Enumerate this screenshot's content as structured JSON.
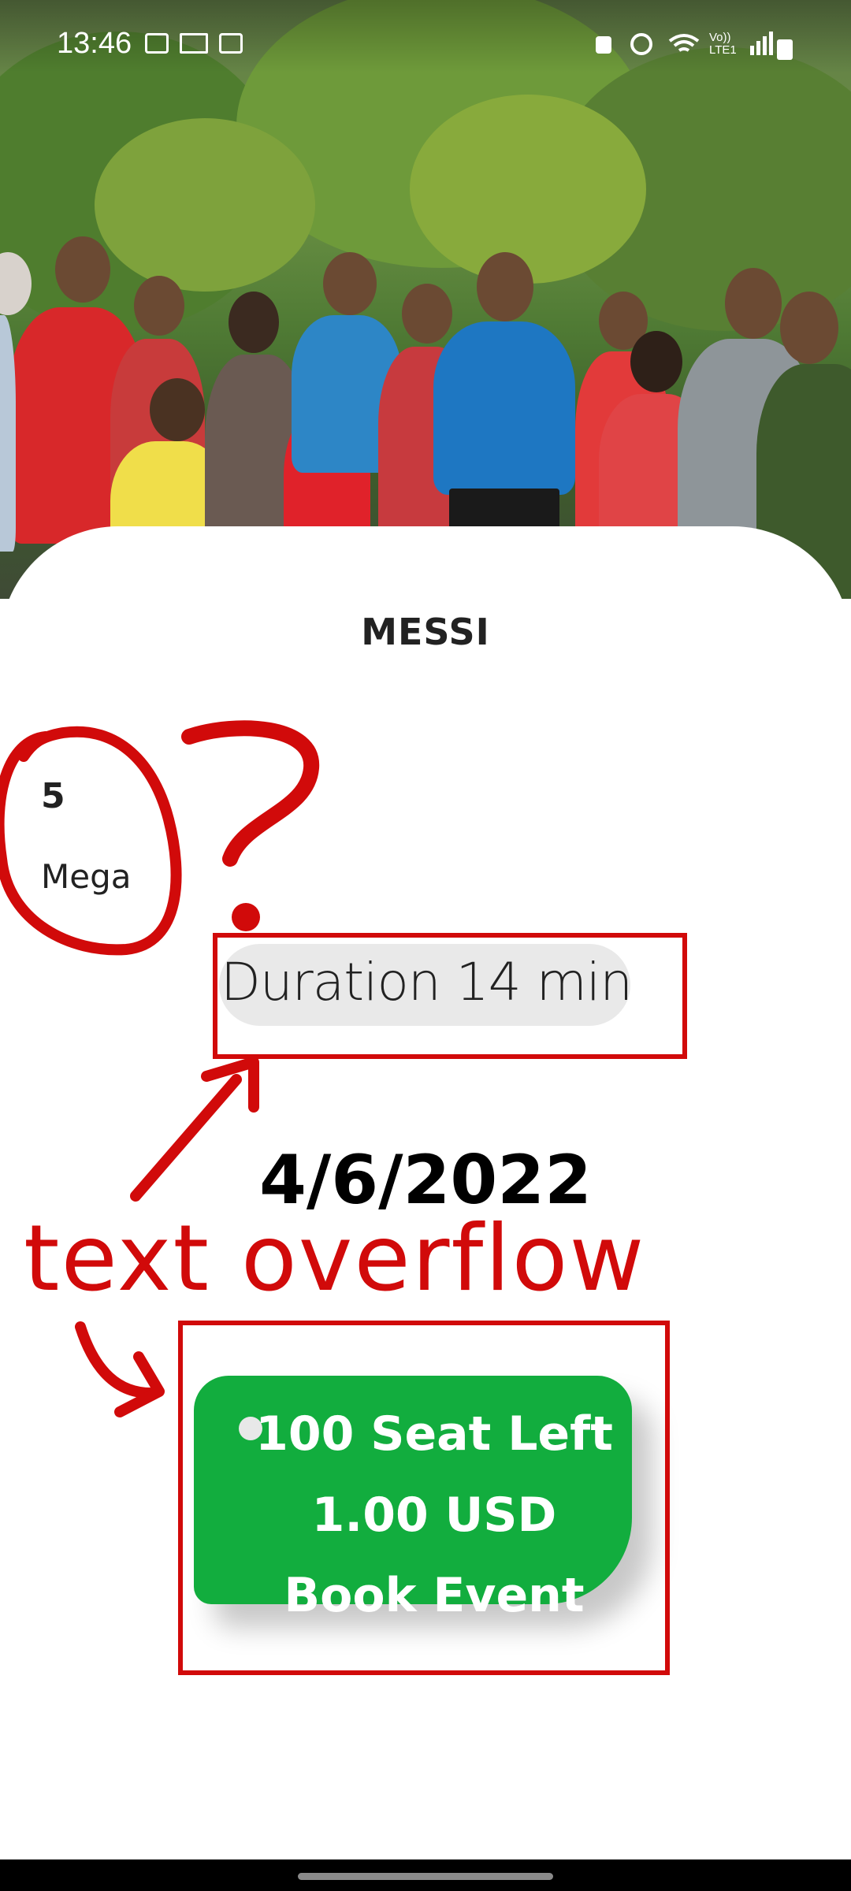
{
  "status_bar": {
    "time": "13:46",
    "network_label": "Vo)) LTE1",
    "left_icons": [
      "gallery-icon",
      "laptop-icon",
      "news-icon"
    ],
    "right_icons": [
      "lock-icon",
      "alarm-icon",
      "wifi-icon",
      "signal-icon",
      "battery-icon"
    ]
  },
  "event": {
    "title": "MESSI",
    "count": "5",
    "category": "Mega",
    "duration": "Duration 14 min",
    "date": "4/6/2022"
  },
  "book_button": {
    "seats": "100 Seat Left",
    "price": "1.00 USD",
    "action": "Book Event"
  },
  "annotations": {
    "label": "text overflow",
    "color": "#d10a0a"
  },
  "colors": {
    "button_green": "#12ad3e",
    "duration_pill": "#e9e9e9"
  }
}
